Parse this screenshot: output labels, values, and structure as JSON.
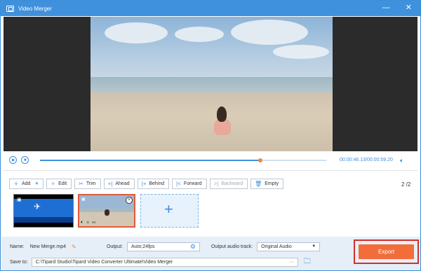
{
  "window": {
    "title": "Video Merger",
    "minimize_glyph": "—",
    "close_glyph": "✕"
  },
  "player": {
    "current_time": "00:00:46.13",
    "separator": "/",
    "total_time": "00:00:59.20",
    "progress": 0.77,
    "play_icon": "play-icon",
    "stop_icon": "stop-icon",
    "volume_icon": "volume-icon"
  },
  "toolbar": {
    "add": "Add",
    "edit": "Edit",
    "trim": "Trim",
    "ahead": "Ahead",
    "behind": "Behind",
    "forward": "Forward",
    "backward": "Backward",
    "empty": "Empty",
    "page": "2 /2"
  },
  "bottom": {
    "name_label": "Name:",
    "name_value": "New Merge.mp4",
    "output_label": "Output:",
    "output_value": "Auto;24fps",
    "audio_label": "Output audio track:",
    "audio_value": "Original Audio",
    "save_label": "Save to:",
    "save_path": "C:\\Tipard Studio\\Tipard Video Converter Ultimate\\Video Merger",
    "browse": "···",
    "export": "Export"
  },
  "colors": {
    "accent": "#3f90dd",
    "export": "#f36d3a",
    "highlight": "#d1302b"
  }
}
